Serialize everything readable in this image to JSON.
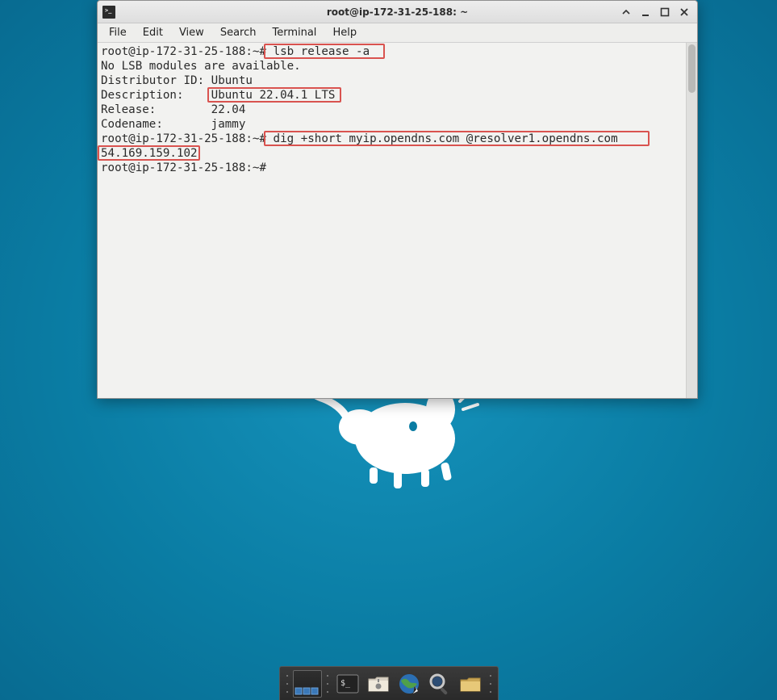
{
  "window": {
    "title": "root@ip-172-31-25-188: ~"
  },
  "menubar": {
    "items": [
      "File",
      "Edit",
      "View",
      "Search",
      "Terminal",
      "Help"
    ]
  },
  "terminal": {
    "prompt": "root@ip-172-31-25-188:~#",
    "line1_cmd": " lsb_release -a",
    "line2": "No LSB modules are available.",
    "line3": "Distributor ID: Ubuntu",
    "line4a": "Description:    ",
    "line4b": "Ubuntu 22.04.1 LTS",
    "line5": "Release:        22.04",
    "line6": "Codename:       jammy",
    "line7_cmd": " dig +short myip.opendns.com @resolver1.opendns.com",
    "line8": "54.169.159.102",
    "line9_trail": " "
  },
  "dock": {
    "items": [
      "show-desktop",
      "terminal",
      "file-manager",
      "web-browser",
      "magnifier",
      "folder"
    ]
  }
}
